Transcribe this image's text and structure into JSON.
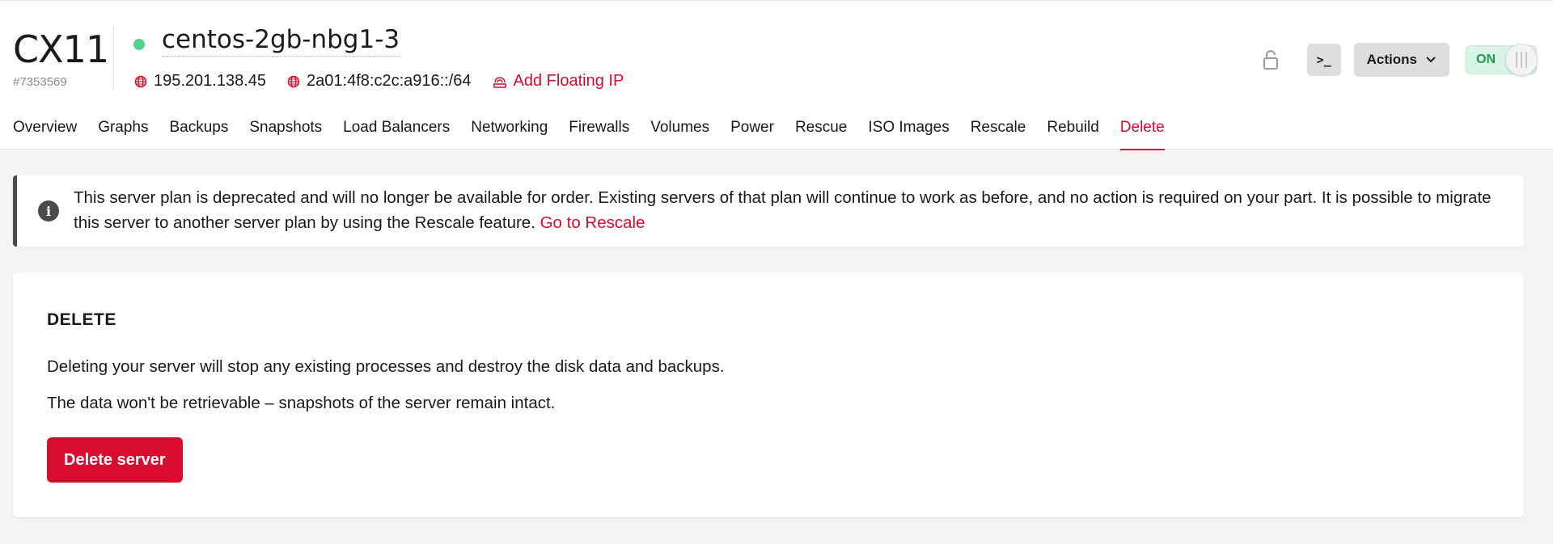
{
  "server": {
    "plan": "CX11",
    "id": "#7353569",
    "name": "centos-2gb-nbg1-3",
    "status_color": "#4fd48a",
    "ipv4": "195.201.138.45",
    "ipv6": "2a01:4f8:c2c:a916::/64",
    "floating_ip_label": "Add Floating IP"
  },
  "toolbar": {
    "lock_icon": "lock-icon",
    "console_label": ">_",
    "actions_label": "Actions",
    "power_toggle_label": "ON"
  },
  "tabs": [
    {
      "label": "Overview"
    },
    {
      "label": "Graphs"
    },
    {
      "label": "Backups"
    },
    {
      "label": "Snapshots"
    },
    {
      "label": "Load Balancers"
    },
    {
      "label": "Networking"
    },
    {
      "label": "Firewalls"
    },
    {
      "label": "Volumes"
    },
    {
      "label": "Power"
    },
    {
      "label": "Rescue"
    },
    {
      "label": "ISO Images"
    },
    {
      "label": "Rescale"
    },
    {
      "label": "Rebuild"
    },
    {
      "label": "Delete",
      "active": true
    }
  ],
  "notice": {
    "icon": "info-icon",
    "text": "This server plan is deprecated and will no longer be available for order. Existing servers of that plan will continue to work as before, and no action is required on your part. It is possible to migrate this server to another server plan by using the Rescale feature.",
    "link_label": "Go to Rescale"
  },
  "delete_section": {
    "title": "DELETE",
    "paragraph_1": "Deleting your server will stop any existing processes and destroy the disk data and backups.",
    "paragraph_2": "The data won't be retrievable – snapshots of the server remain intact.",
    "button_label": "Delete server"
  },
  "colors": {
    "accent": "#d50c2d",
    "status_on": "#4fd48a",
    "toggle_bg": "#d9f5e5"
  }
}
